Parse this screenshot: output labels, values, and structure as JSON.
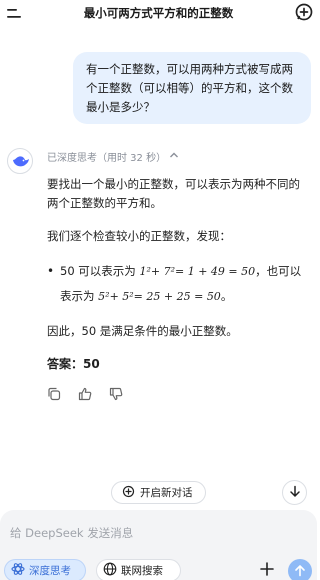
{
  "header": {
    "title": "最小可两方式平方和的正整数"
  },
  "user_message": {
    "text": "有一个正整数，可以用两种方式被写成两个正整数（可以相等）的平方和，这个数最小是多少？"
  },
  "thinking": {
    "label": "已深度思考（用时 32 秒）"
  },
  "answer": {
    "p1": "要找出一个最小的正整数，可以表示为两种不同的两个正整数的平方和。",
    "p2": "我们逐个检查较小的正整数，发现：",
    "bullet_prefix": "50 可以表示为",
    "bullet_mid": "，也可以表示为",
    "math1": "1²+ 7²= 1 + 49 = 50",
    "math2": "5²+ 5²= 25 + 25 = 50",
    "bullet_end": "。",
    "p3": "因此，50 是满足条件的最小正整数。",
    "final": "答案：50"
  },
  "controls": {
    "new_chat_label": "开启新对话",
    "input_placeholder": "给 DeepSeek 发送消息",
    "deep_think_label": "深度思考",
    "web_search_label": "联网搜索"
  },
  "colors": {
    "accent": "#3b6fd6",
    "bubble": "#e7f1fe",
    "send": "#8fbaf6"
  }
}
